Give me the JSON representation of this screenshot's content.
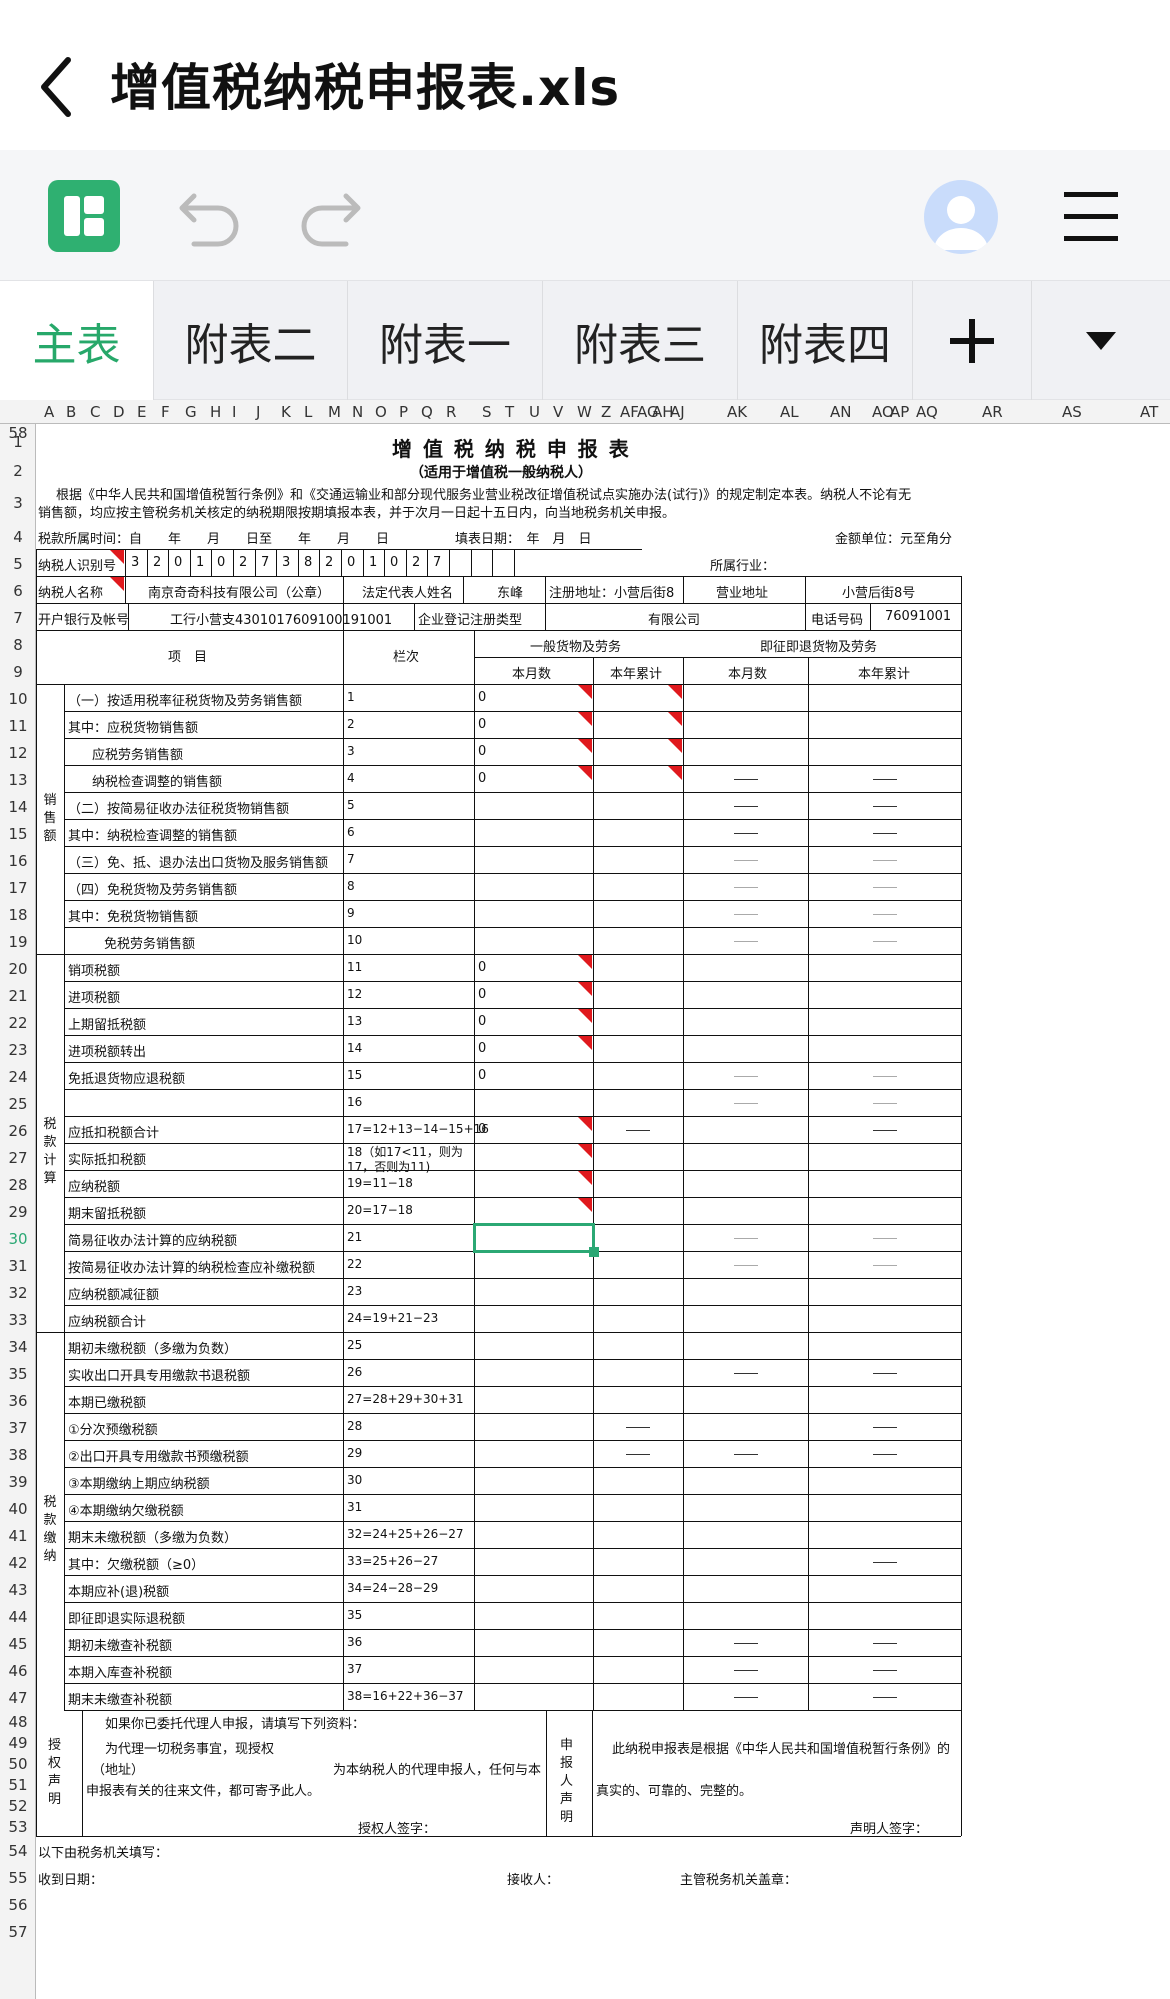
{
  "app": {
    "title": "增值税纳税申报表.xls"
  },
  "tabs": [
    "主表",
    "附表二",
    "附表一",
    "附表三",
    "附表四"
  ],
  "columns": [
    "A",
    "B",
    "C",
    "D",
    "E",
    "F",
    "G",
    "H",
    "I",
    "J",
    "K",
    "L",
    "M",
    "N",
    "O",
    "P",
    "Q",
    "R",
    "S",
    "T",
    "U",
    "V",
    "W",
    "Z",
    "AF",
    "AG",
    "AH",
    "AJ",
    "AK",
    "AL",
    "AN",
    "AO",
    "AP",
    "AQ",
    "AR",
    "AS",
    "AT"
  ],
  "form": {
    "title": "增 值 税 纳 税 申 报 表",
    "subtitle": "（适用于增值税一般纳税人）",
    "intro_1": "根据《中华人民共和国增值税暂行条例》和《交通运输业和部分现代服务业营业税改征增值税试点实施办法(试行)》的规定制定本表。纳税人不论有无",
    "intro_2": "销售额，均应按主管税务机关核定的纳税期限按期填报本表，并于次月一日起十五日内，向当地税务机关申报。",
    "period_label": "税款所属时间：自　　年　　月　　日至　　年　　月　　日",
    "fill_date_label": "填表日期：　年　月　日",
    "unit_label": "金额单位：元至角分",
    "taxpayer_id_label": "纳税人识别号",
    "taxpayer_id_digits": [
      "3",
      "2",
      "0",
      "1",
      "0",
      "2",
      "7",
      "3",
      "8",
      "2",
      "0",
      "1",
      "0",
      "2",
      "7"
    ],
    "industry_label": "所属行业：",
    "name_label": "纳税人名称",
    "name_value": "南京奇奇科技有限公司（公章）",
    "legal_label": "法定代表人姓名",
    "legal_value": "东峰",
    "reg_addr_label": "注册地址：小营后街8",
    "biz_addr_label": "营业地址",
    "biz_addr_value": "小营后街8号",
    "bank_label": "开户银行及帐号",
    "bank_value": "工行小营支4301017609100191001",
    "reg_type_label": "企业登记注册类型",
    "reg_type_value": "有限公司",
    "phone_label": "电话号码",
    "phone_value": "76091001",
    "h_item": "项　目",
    "h_col": "栏次",
    "h_general": "一般货物及劳务",
    "h_refund": "即征即退货物及劳务",
    "h_month": "本月数",
    "h_year": "本年累计",
    "sec_sales": "销售额",
    "sec_calc": "税款计算",
    "sec_pay": "税款缴纳",
    "rows": [
      {
        "item": "（一）按适用税率征税货物及劳务销售额",
        "col": "1",
        "v": "0"
      },
      {
        "item": "其中：应税货物销售额",
        "col": "2",
        "v": "0"
      },
      {
        "item": "应税劳务销售额",
        "col": "3",
        "v": "0"
      },
      {
        "item": "纳税检查调整的销售额",
        "col": "4",
        "v": "0"
      },
      {
        "item": "（二）按简易征收办法征税货物销售额",
        "col": "5",
        "v": ""
      },
      {
        "item": "其中：纳税检查调整的销售额",
        "col": "6",
        "v": ""
      },
      {
        "item": "（三）免、抵、退办法出口货物及服务销售额",
        "col": "7",
        "v": ""
      },
      {
        "item": "（四）免税货物及劳务销售额",
        "col": "8",
        "v": ""
      },
      {
        "item": "其中：免税货物销售额",
        "col": "9",
        "v": ""
      },
      {
        "item": "免税劳务销售额",
        "col": "10",
        "v": ""
      },
      {
        "item": "销项税额",
        "col": "11",
        "v": "0"
      },
      {
        "item": "进项税额",
        "col": "12",
        "v": "0"
      },
      {
        "item": "上期留抵税额",
        "col": "13",
        "v": "0"
      },
      {
        "item": "进项税额转出",
        "col": "14",
        "v": "0"
      },
      {
        "item": "免抵退货物应退税额",
        "col": "15",
        "v": "0"
      },
      {
        "item": "",
        "col": "16",
        "v": ""
      },
      {
        "item": "应抵扣税额合计",
        "col": "17=12+13−14−15+16",
        "v": "0"
      },
      {
        "item": "实际抵扣税额",
        "col": "18（如17<11，则为17，否则为11)",
        "v": ""
      },
      {
        "item": "应纳税额",
        "col": "19=11−18",
        "v": ""
      },
      {
        "item": "期末留抵税额",
        "col": "20=17−18",
        "v": ""
      },
      {
        "item": "简易征收办法计算的应纳税额",
        "col": "21",
        "v": ""
      },
      {
        "item": "按简易征收办法计算的纳税检查应补缴税额",
        "col": "22",
        "v": ""
      },
      {
        "item": "应纳税额减征额",
        "col": "23",
        "v": ""
      },
      {
        "item": "应纳税额合计",
        "col": "24=19+21−23",
        "v": ""
      },
      {
        "item": "期初未缴税额（多缴为负数）",
        "col": "25",
        "v": ""
      },
      {
        "item": "实收出口开具专用缴款书退税额",
        "col": "26",
        "v": ""
      },
      {
        "item": "本期已缴税额",
        "col": "27=28+29+30+31",
        "v": ""
      },
      {
        "item": "①分次预缴税额",
        "col": "28",
        "v": ""
      },
      {
        "item": "②出口开具专用缴款书预缴税额",
        "col": "29",
        "v": ""
      },
      {
        "item": "③本期缴纳上期应纳税额",
        "col": "30",
        "v": ""
      },
      {
        "item": "④本期缴纳欠缴税额",
        "col": "31",
        "v": ""
      },
      {
        "item": "期末未缴税额（多缴为负数）",
        "col": "32=24+25+26−27",
        "v": ""
      },
      {
        "item": "其中：欠缴税额（≥0）",
        "col": "33=25+26−27",
        "v": ""
      },
      {
        "item": "本期应补(退)税额",
        "col": "34=24−28−29",
        "v": ""
      },
      {
        "item": "即征即退实际退税额",
        "col": "35",
        "v": ""
      },
      {
        "item": "期初未缴查补税额",
        "col": "36",
        "v": ""
      },
      {
        "item": "本期入库查补税额",
        "col": "37",
        "v": ""
      },
      {
        "item": "期末未缴查补税额",
        "col": "38=16+22+36−37",
        "v": ""
      }
    ],
    "auth_title": "授权声明",
    "auth_l1": "如果你已委托代理人申报，请填写下列资料：",
    "auth_l2": "为代理一切税务事宜，现授权",
    "auth_l3": "（地址）",
    "auth_l3b": "为本纳税人的代理申报人，任何与本",
    "auth_l4": "申报表有关的往来文件，都可寄予此人。",
    "auth_sign": "授权人签字：",
    "decl_title": "申报人声明",
    "decl_l1": "此纳税申报表是根据《中华人民共和国增值税暂行条例》的",
    "decl_l2": "真实的、可靠的、完整的。",
    "decl_sign": "声明人签字：",
    "tax_office": "以下由税务机关填写：",
    "recv_date": "收到日期：",
    "receiver": "接收人：",
    "seal": "主管税务机关盖章："
  }
}
